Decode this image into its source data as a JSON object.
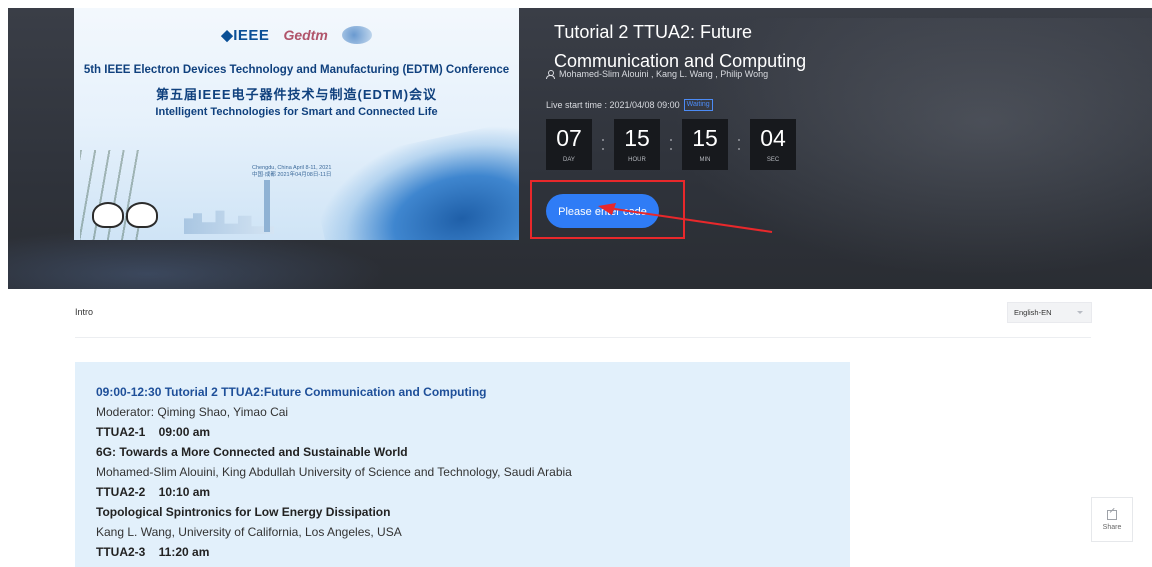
{
  "banner": {
    "logo_ieee": "◆IEEE",
    "logo_edtm": "Gedtm",
    "title_en": "5th IEEE Electron Devices Technology and Manufacturing (EDTM) Conference",
    "title_cn": "第五届IEEE电子器件技术与制造(EDTM)会议",
    "slogan": "Intelligent Technologies for Smart and Connected Life",
    "city_line1": "Chengdu, China April 8-11, 2021",
    "city_line2": "中国·成都 2021年04月08日-11日"
  },
  "event": {
    "title": "Tutorial 2 TTUA2: Future Communication and Computing",
    "authors": "Mohamed-Slim Alouini , Kang L. Wang , Philip Wong",
    "live_label": "Live start time : 2021/04/08 09:00",
    "status": "Waiting",
    "countdown": [
      {
        "value": "07",
        "label": "DAY"
      },
      {
        "value": "15",
        "label": "HOUR"
      },
      {
        "value": "15",
        "label": "MIN"
      },
      {
        "value": "04",
        "label": "SEC"
      }
    ],
    "enter_button": "Please enter code"
  },
  "tabs": {
    "intro": "Intro"
  },
  "language": {
    "selected": "English-EN"
  },
  "agenda": {
    "heading": "09:00-12:30 Tutorial 2 TTUA2:Future Communication and Computing",
    "moderator": "Moderator: Qiming Shao, Yimao Cai",
    "items": [
      {
        "code": "TTUA2-1    09:00 am",
        "title": "6G: Towards a More Connected and Sustainable World",
        "speaker": "Mohamed-Slim Alouini, King Abdullah University of Science and Technology, Saudi Arabia"
      },
      {
        "code": "TTUA2-2    10:10 am",
        "title": "Topological Spintronics for Low Energy Dissipation",
        "speaker": "Kang L. Wang, University of California, Los Angeles, USA"
      },
      {
        "code": "TTUA2-3    11:20 am"
      }
    ]
  },
  "share": {
    "label": "Share"
  },
  "colors": {
    "accent": "#2f7cf6",
    "annotation": "#e8282b",
    "agenda_bg": "#e2f0fb",
    "heading": "#1e4f99"
  }
}
